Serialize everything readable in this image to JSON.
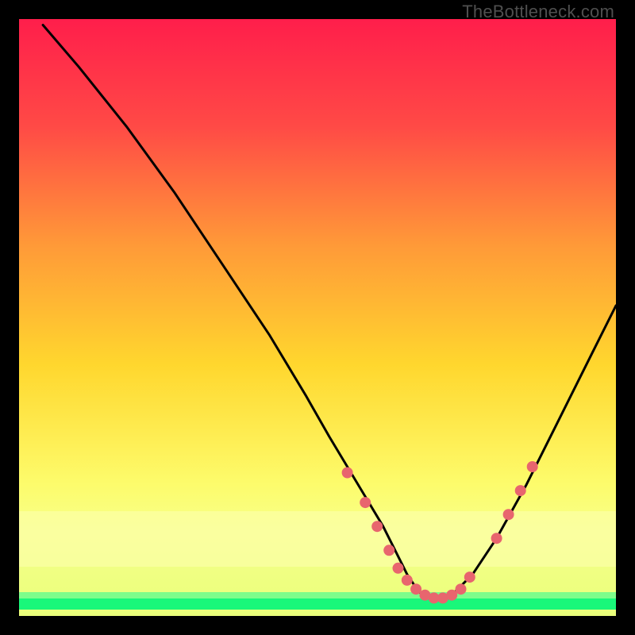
{
  "watermark": "TheBottleneck.com",
  "chart_data": {
    "type": "line",
    "title": "",
    "xlabel": "",
    "ylabel": "",
    "xlim": [
      0,
      100
    ],
    "ylim": [
      0,
      100
    ],
    "background_gradient": {
      "top": "#ff1e4b",
      "upper_mid": "#ff7a3a",
      "mid": "#ffd72e",
      "lower": "#fdfc6c",
      "bottom_band_top": "#e9ff7a",
      "green": "#19f77a"
    },
    "curve": {
      "x": [
        4,
        10,
        18,
        26,
        34,
        42,
        48,
        52,
        55,
        58,
        61,
        63,
        65,
        67,
        69,
        71,
        73,
        76,
        80,
        85,
        90,
        96,
        100
      ],
      "y": [
        99,
        92,
        82,
        71,
        59,
        47,
        37,
        30,
        25,
        20,
        15,
        11,
        7,
        4,
        3,
        3,
        4,
        7,
        13,
        22,
        32,
        44,
        52
      ]
    },
    "markers": {
      "x": [
        55,
        58,
        60,
        62,
        63.5,
        65,
        66.5,
        68,
        69.5,
        71,
        72.5,
        74,
        75.5,
        80,
        82,
        84,
        86
      ],
      "y": [
        24,
        19,
        15,
        11,
        8,
        6,
        4.5,
        3.5,
        3,
        3,
        3.5,
        4.5,
        6.5,
        13,
        17,
        21,
        25
      ],
      "color": "#e8656e",
      "radius": 7
    }
  }
}
